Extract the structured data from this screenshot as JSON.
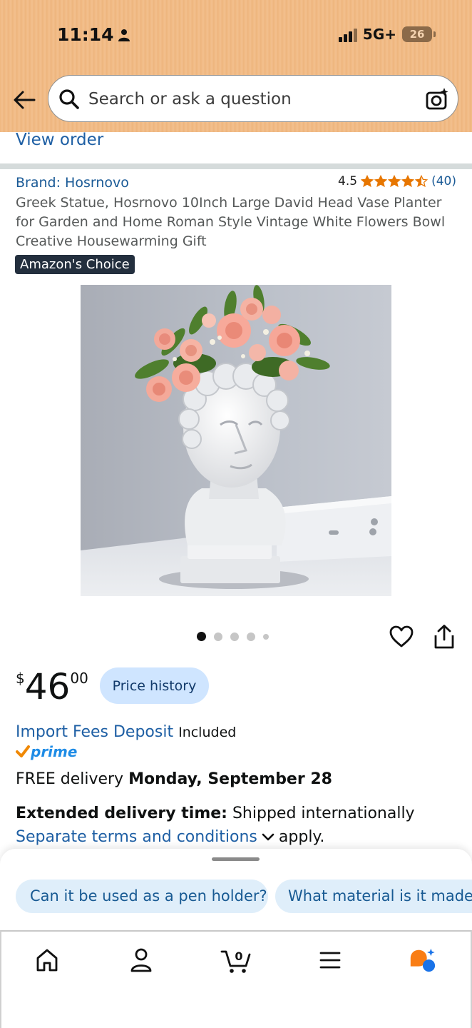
{
  "status_bar": {
    "time": "11:14",
    "network": "5G+",
    "battery": "26"
  },
  "header": {
    "search_placeholder": "Search or ask a question"
  },
  "order": {
    "view_order": "View order"
  },
  "product": {
    "brand": "Brand: Hosrnovo",
    "rating": "4.5",
    "rating_value": 4.5,
    "review_count": "(40)",
    "title": "Greek Statue, Hosrnovo 10Inch Large David Head Vase Planter for Garden and Home Roman Style Vintage White Flowers Bowl Creative Housewarming Gift",
    "badge": "Amazon's Choice",
    "image_count": 5,
    "active_image": 1
  },
  "price": {
    "currency": "$",
    "whole": "46",
    "fraction": "00",
    "history_button": "Price history"
  },
  "fees": {
    "import_fees": "Import Fees Deposit",
    "included": "Included",
    "prime": "prime"
  },
  "delivery": {
    "free_text": "FREE delivery",
    "date": "Monday, September 28",
    "extended_label": "Extended delivery time:",
    "extended_value": "Shipped internationally",
    "terms_link": "Separate terms and conditions",
    "terms_suffix": "apply."
  },
  "suggestions": [
    "Can it be used as a pen holder?",
    "What material is it made of?"
  ],
  "nav": {
    "cart_count": "0",
    "items": [
      "home-icon",
      "account-icon",
      "cart-icon",
      "menu-icon",
      "rufus-icon"
    ]
  },
  "colors": {
    "header_bg": "#efb77f",
    "link": "#1e5fa4",
    "star": "#e77600",
    "chip_bg": "#dfeefa",
    "prime_blue": "#1f8ce6",
    "prime_check": "#f08804"
  }
}
